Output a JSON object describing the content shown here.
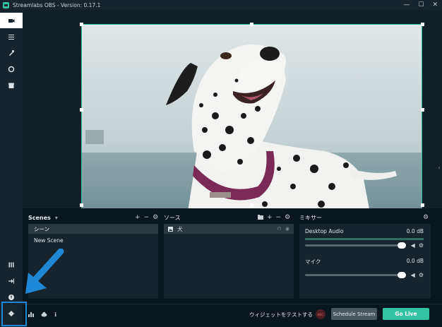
{
  "window": {
    "title": "Streamlabs OBS - Version: 0.17.1",
    "minimize_glyph": "—",
    "maximize_glyph": "☐",
    "close_glyph": "✕"
  },
  "nav": {
    "items": [
      {
        "icon": "studio-icon",
        "active": true
      },
      {
        "icon": "editor-icon",
        "active": false
      },
      {
        "icon": "themes-icon",
        "active": false
      },
      {
        "icon": "chat-icon",
        "active": false
      },
      {
        "icon": "store-icon",
        "active": false
      }
    ],
    "bottom_items": [
      {
        "icon": "library-icon"
      },
      {
        "icon": "logout-icon"
      },
      {
        "icon": "help-icon"
      },
      {
        "icon": "settings-icon"
      }
    ]
  },
  "scenes": {
    "title": "Scenes",
    "dropdown_glyph": "▾",
    "add_glyph": "+",
    "remove_glyph": "−",
    "settings_glyph": "⚙",
    "items": [
      "シーン",
      "New Scene"
    ],
    "selected_index": 0
  },
  "sources": {
    "title": "ソース",
    "add_glyph": "+",
    "remove_glyph": "−",
    "settings_glyph": "⚙",
    "items": [
      {
        "name": "犬"
      }
    ]
  },
  "mixer": {
    "title": "ミキサー",
    "settings_glyph": "⚙",
    "channels": [
      {
        "name": "Desktop Audio",
        "db": "0.0 dB",
        "level": 1.0
      },
      {
        "name": "マイク",
        "db": "0.0 dB",
        "level": 1.0
      }
    ]
  },
  "footer": {
    "test_widgets_label": "ウィジェットをテストする",
    "rec_label": "REC",
    "schedule_label": "Schedule Stream",
    "golive_label": "Go Live",
    "info_glyph": "ℹ"
  },
  "colors": {
    "accent": "#31c3a2",
    "background": "#09161d",
    "panel": "#17242d",
    "annotation": "#1f88d6"
  }
}
